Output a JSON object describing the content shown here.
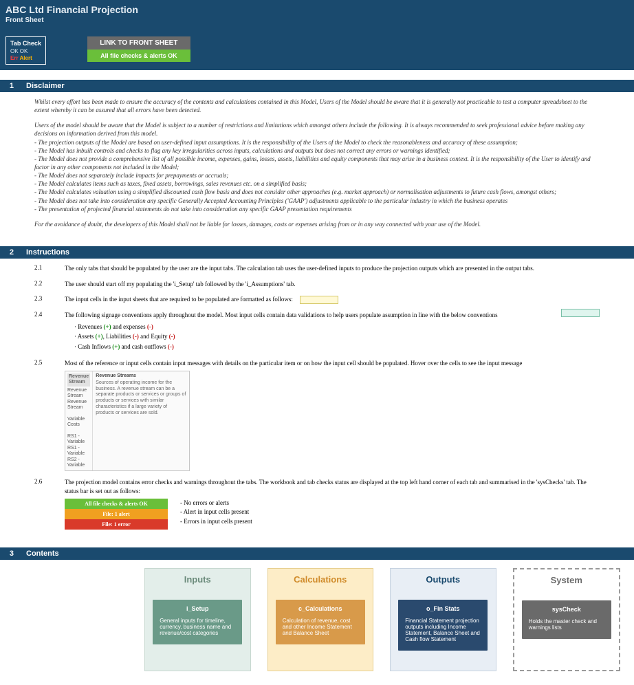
{
  "header": {
    "title": "ABC Ltd Financial Projection",
    "subtitle": "Front Sheet"
  },
  "tabCheck": {
    "title": "Tab Check",
    "row1": "OK  OK",
    "errLabel": "Err ",
    "alertLabel": "Alert"
  },
  "linkBox": {
    "top": "LINK TO FRONT SHEET",
    "bottom": "All file checks & alerts OK"
  },
  "sections": {
    "s1": {
      "num": "1",
      "title": "Disclaimer"
    },
    "s2": {
      "num": "2",
      "title": "Instructions"
    },
    "s3": {
      "num": "3",
      "title": "Contents"
    }
  },
  "disclaimer": {
    "p1": "Whilst every effort has been made to ensure the accuracy of the contents and calculations contained in this Model, Users of the Model should be aware that it is generally not practicable to test a computer spreadsheet to the extent whereby it can be assured that all errors have been detected.",
    "p2": "Users of the model should be aware that the Model is subject to a number of restrictions and limitations which amongst others include the following. It is always recommended to seek professional advice before making any decisions on information derived from this model.",
    "b1": "- The projection outputs of the Model are based on user-defined input assumptions. It is the responsibility of the Users of the Model to check the reasonableness and accuracy of these assumption;",
    "b2": "- The Model has inbuilt controls and checks to flag any key irregularities across inputs, calculations and outputs but does not correct any errors or warnings identified;",
    "b3": "- The Model does not provide a comprehensive list of all possible income, expenses, gains, losses, assets, liabilities and equity components that may arise in a business context. It is the responsibility of the User to identify and factor in any other components not included in the Model;",
    "b4": "- The Model does not separately include impacts for prepayments or accruals;",
    "b5": "- The Model calculates items such as taxes, fixed assets, borrowings, sales revenues etc. on a simplified basis;",
    "b6": "- The Model calculates valuation using a simplified discounted cash flow basis and does not consider other approaches (e.g. market approach) or normalisation adjustments to future cash flows, amongst others;",
    "b7": "- The Model does not take into consideration any specific Generally Accepted Accounting Principles ('GAAP') adjustments applicable to the particular industry in which the business operates",
    "b8": "- The presentation of projected financial statements do not take into consideration any specific GAAP presentation requirements",
    "p3": "For the avoidance of doubt, the developers of this Model shall not be liable for losses, damages, costs or expenses arising from or in any way connected with your use of the Model."
  },
  "instructions": {
    "i21": {
      "num": "2.1",
      "text": "The only tabs that should be populated by the user are the input tabs. The calculation tab uses the user-defined inputs to produce the projection outputs which are presented in the output tabs."
    },
    "i22": {
      "num": "2.2",
      "text": "The user should start off my populating the 'i_Setup' tab followed by the 'i_Assumptions' tab."
    },
    "i23": {
      "num": "2.3",
      "text": "The input cells in the input sheets that are required to be populated are formatted as follows:"
    },
    "i24": {
      "num": "2.4",
      "text": "The following signage conventions apply throughout the model. Most input cells contain data validations to help users populate assumption in line with the below conventions",
      "sub1a": "Revenues ",
      "sub1b": " and expenses ",
      "sub2a": "Assets ",
      "sub2b": ", Liabilities ",
      "sub2c": " and Equity ",
      "sub3a": "Cash Inflows ",
      "sub3b": " and cash outflows ",
      "plus": "(+)",
      "minus": "(-)"
    },
    "i25": {
      "num": "2.5",
      "text": "Most of the reference or input cells contain input messages with details on the particular item or on how the input cell should be populated. Hover over the cells to see the input message"
    },
    "tooltip": {
      "leftHeader": "Revenue Stream",
      "leftLines": "Revenue Stream\nRevenue Stream\n\nVariable Costs\n\nRS1 - Variable\nRS1 - Variable\nRS2 - Variable",
      "title": "Revenue Streams",
      "body": "Sources of operating income for the business. A revenue stream can be a separate products or services or groups of products or services with similar characteristics if a large variety of products or services are sold."
    },
    "i26": {
      "num": "2.6",
      "text": "The projection model contains error checks and warnings throughout the tabs. The workbook and tab checks status are displayed at the top left hand corner of each tab and summarised in the 'sysChecks' tab. The status bar is set out as follows:"
    },
    "status": {
      "ok": "All file checks & alerts OK",
      "okLegend": "- No errors or alerts",
      "alert": "File: 1 alert",
      "alertLegend": "- Alert in input cells present",
      "err": "File: 1 error",
      "errLegend": "- Errors in input cells present"
    }
  },
  "contents": {
    "inputs": {
      "title": "Inputs",
      "subTitle": "i_Setup",
      "subBody": "General inputs for timeline, currency, business name and revenue/cost categories"
    },
    "calc": {
      "title": "Calculations",
      "subTitle": "c_Calculations",
      "subBody": "Calculation of revenue, cost and other Income Statement and Balance Sheet"
    },
    "outputs": {
      "title": "Outputs",
      "subTitle": "o_Fin Stats",
      "subBody": "Financial Statement projection outputs including Income Statement, Balance Sheet and Cash flow Statement"
    },
    "system": {
      "title": "System",
      "subTitle": "sysCheck",
      "subBody": "Holds the master check and warnings lists"
    }
  }
}
